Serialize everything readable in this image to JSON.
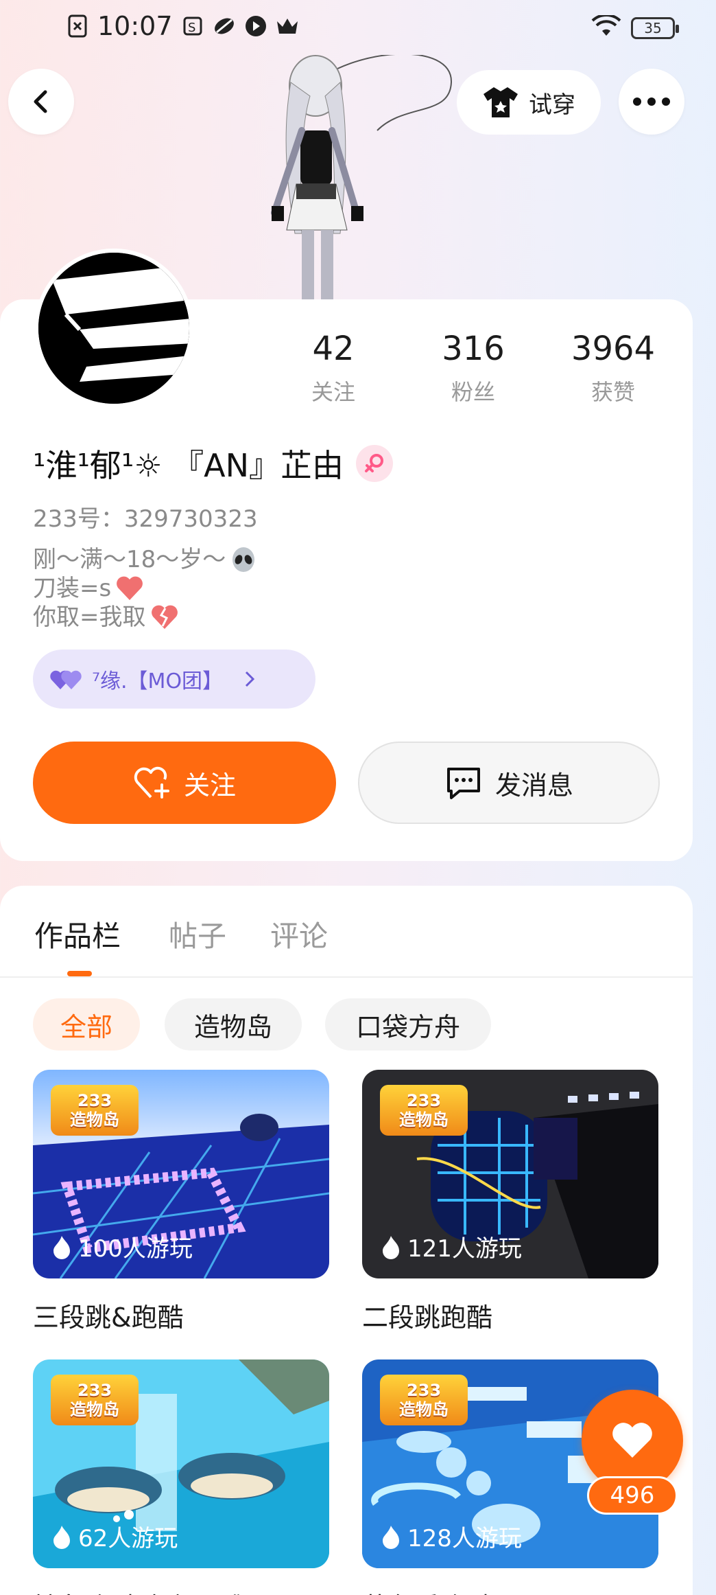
{
  "status_bar": {
    "time": "10:07",
    "battery": "35"
  },
  "header": {
    "tryon_label": "试穿"
  },
  "profile": {
    "stats": [
      {
        "value": "42",
        "label": "关注"
      },
      {
        "value": "316",
        "label": "粉丝"
      },
      {
        "value": "3964",
        "label": "获赞"
      }
    ],
    "name": "¹淮¹郁¹☼ 『AN』芷由",
    "id_line": "233号：329730323",
    "bio": [
      "刚～满～18～岁～",
      "刀装=s",
      "你取=我取"
    ],
    "group_label": "⁷缘.【MO团】",
    "follow_label": "关注",
    "message_label": "发消息"
  },
  "tabs": [
    "作品栏",
    "帖子",
    "评论"
  ],
  "filters": [
    "全部",
    "造物岛",
    "口袋方舟"
  ],
  "badge": {
    "line1": "233",
    "line2": "造物岛"
  },
  "games": [
    {
      "plays": "100人游玩",
      "title": "三段跳&跑酷",
      "theme": "#2a4bd8"
    },
    {
      "plays": "121人游玩",
      "title": "二段跳跑酷",
      "theme": "#1b1f38"
    },
    {
      "plays": "62人游玩",
      "title": "鲸鱼跑酷[超短][难]",
      "theme": "#2bb7e3"
    },
    {
      "plays": "128人游玩",
      "title": "蓝色系跑酷",
      "theme": "#2f7fd8"
    }
  ],
  "like_button": {
    "count": "496"
  },
  "colors": {
    "accent": "#ff6a10",
    "group_chip": "#eae6fb"
  }
}
